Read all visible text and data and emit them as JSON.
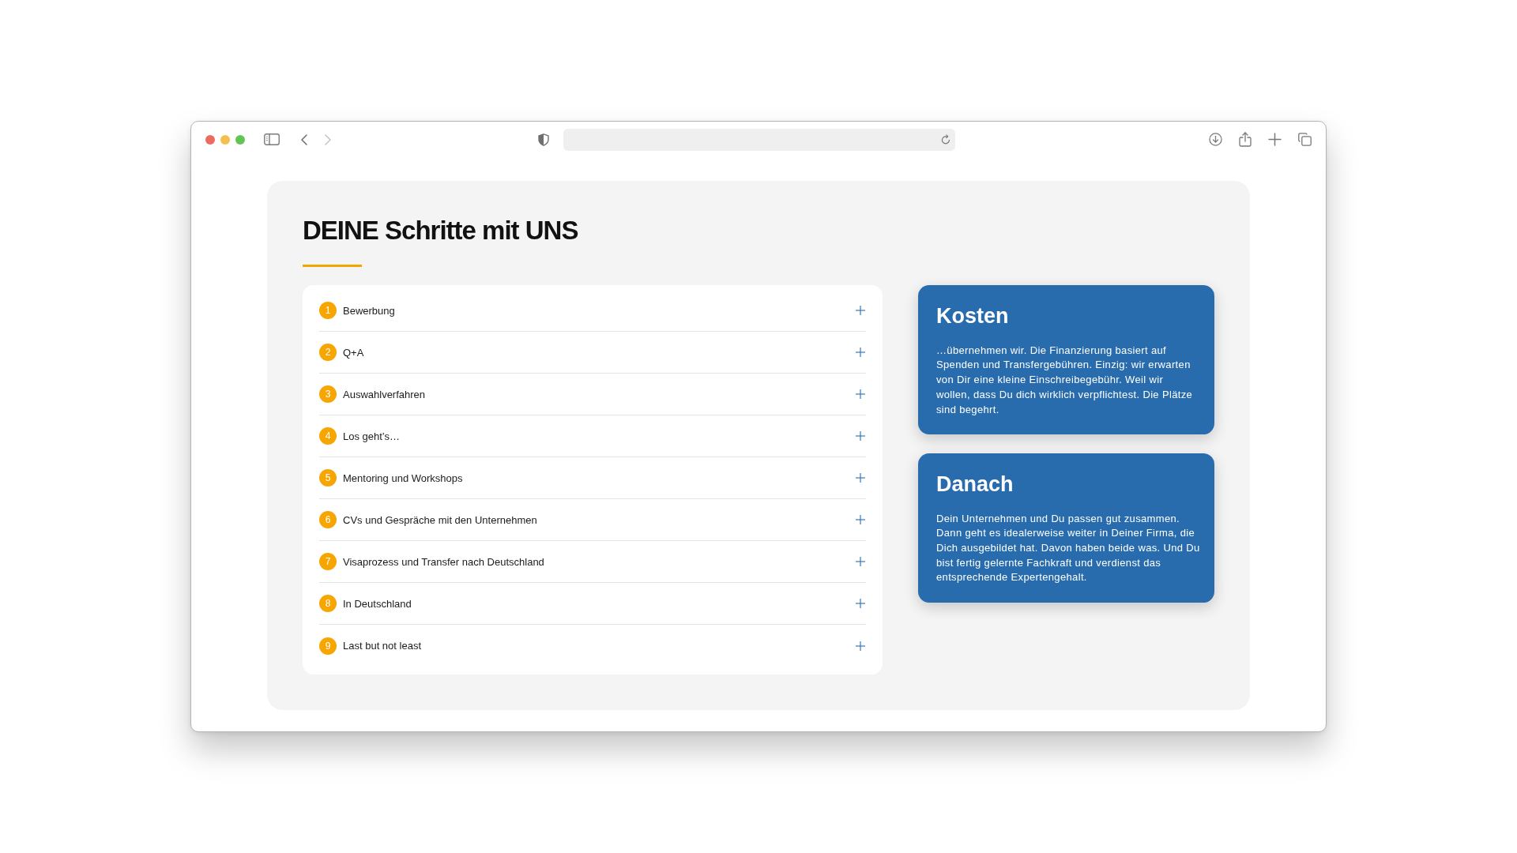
{
  "browser": {
    "nav_buttons": [
      {
        "kind": "back",
        "disabled": false
      },
      {
        "kind": "forward",
        "disabled": true
      }
    ]
  },
  "section": {
    "title": "DEINE Schritte mit UNS",
    "steps": [
      {
        "number": "1",
        "label": "Bewerbung",
        "expanded": false
      },
      {
        "number": "2",
        "label": "Q+A",
        "expanded": false
      },
      {
        "number": "3",
        "label": "Auswahlverfahren",
        "expanded": false
      },
      {
        "number": "4",
        "label": "Los geht’s…",
        "expanded": false
      },
      {
        "number": "5",
        "label": "Mentoring und Workshops",
        "expanded": false
      },
      {
        "number": "6",
        "label": "CVs und Gespräche mit den Unternehmen",
        "expanded": false
      },
      {
        "number": "7",
        "label": "Visaprozess und Transfer nach Deutschland",
        "expanded": false
      },
      {
        "number": "8",
        "label": "In Deutschland",
        "expanded": false
      },
      {
        "number": "9",
        "label": "Last but not least",
        "expanded": false
      }
    ],
    "cards": [
      {
        "title": "Kosten",
        "text": "…übernehmen wir. Die Finanzierung basiert auf Spenden und Transfergebühren. Einzig: wir erwarten von Dir eine kleine Einschreibegebühr. Weil wir wollen, dass Du dich wirklich verpflichtest. Die Plätze sind begehrt."
      },
      {
        "title": "Danach",
        "text": "Dein Unternehmen und Du passen gut zusammen. Dann geht es idealerweise weiter in Deiner Firma, die Dich ausgebildet hat. Davon haben beide was. Und Du bist fertig gelernte Fachkraft und verdienst das entsprechende Expertengehalt."
      }
    ]
  }
}
